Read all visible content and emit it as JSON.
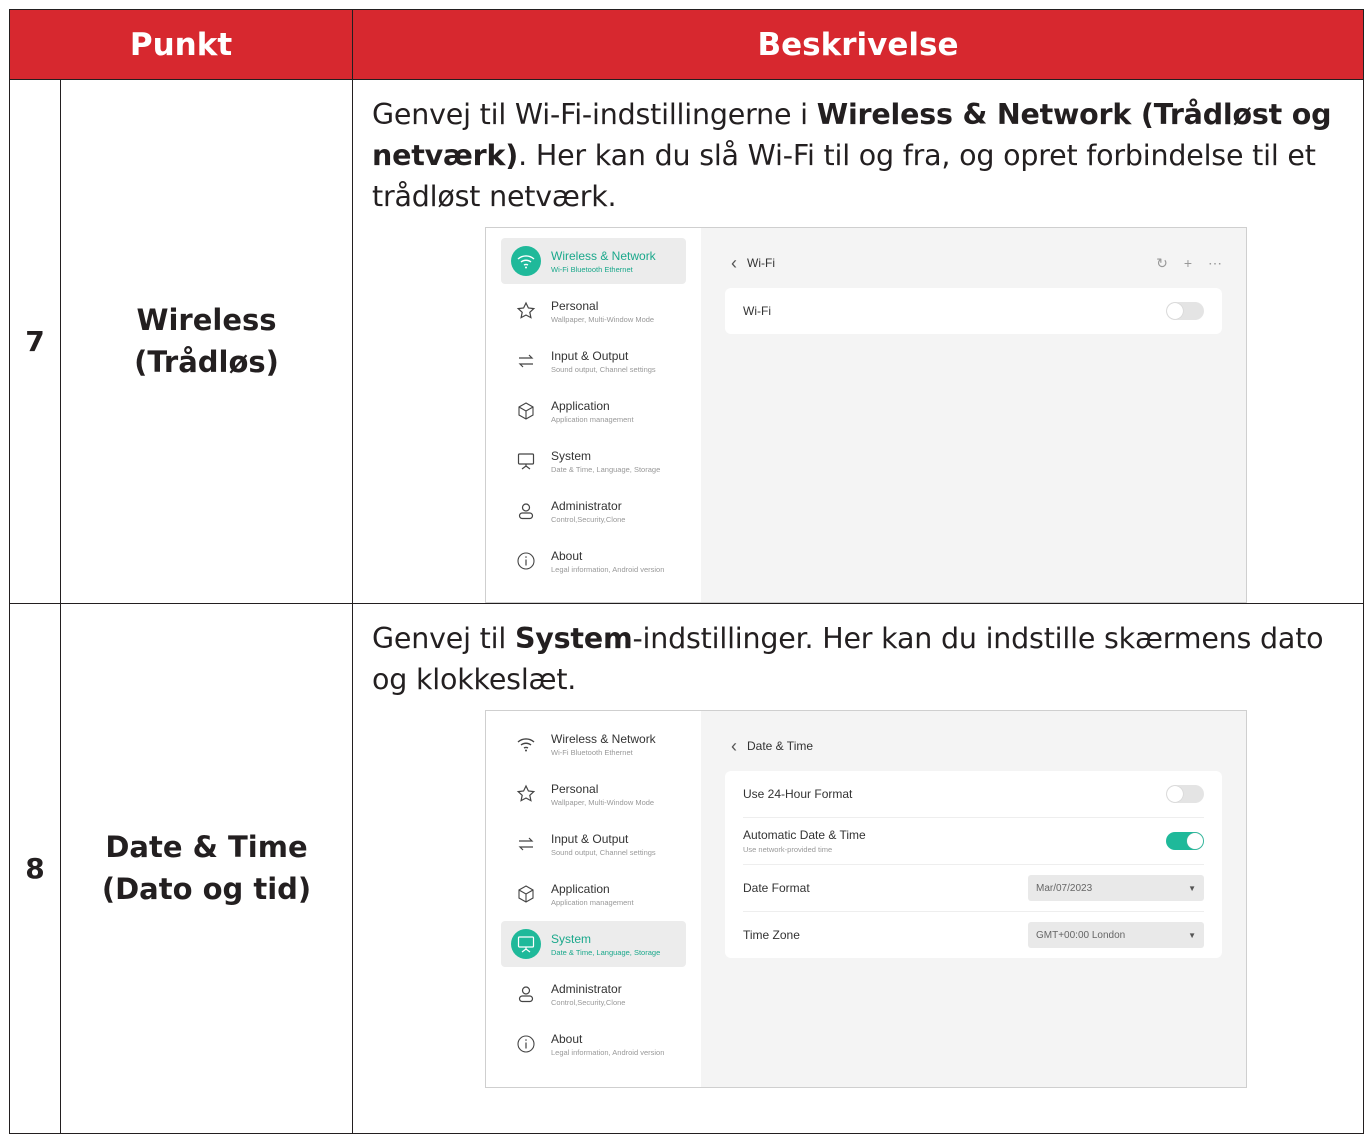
{
  "header": {
    "col1": "Punkt",
    "col2": "Beskrivelse"
  },
  "rows": [
    {
      "num": "7",
      "item_line1": "Wireless",
      "item_line2": "(Trådløs)",
      "desc_pre": "Genvej til Wi-Fi-indstillingerne i ",
      "desc_bold": "Wireless & Network (Trådløst og netværk)",
      "desc_post": ". Her kan du slå Wi-Fi til og fra, og opret forbindelse til et trådløst netværk.",
      "screen": {
        "title": "Wi-Fi",
        "rows": [
          {
            "label": "Wi-Fi"
          }
        ]
      }
    },
    {
      "num": "8",
      "item_line1": "Date & Time",
      "item_line2": "(Dato og tid)",
      "desc_pre": "Genvej til ",
      "desc_bold": "System",
      "desc_post": "-indstillinger. Her kan du indstille skærmens dato og klokkeslæt.",
      "screen": {
        "title": "Date & Time",
        "rows": [
          {
            "label": "Use 24-Hour Format"
          },
          {
            "label": "Automatic Date & Time",
            "sub": "Use network-provided time"
          },
          {
            "label": "Date Format",
            "value": "Mar/07/2023"
          },
          {
            "label": "Time Zone",
            "value": "GMT+00:00 London"
          }
        ]
      }
    }
  ],
  "sidebar": {
    "items": [
      {
        "title": "Wireless & Network",
        "sub": "Wi-Fi Bluetooth Ethernet",
        "icon": "wifi-icon"
      },
      {
        "title": "Personal",
        "sub": "Wallpaper, Multi-Window Mode",
        "icon": "star-icon"
      },
      {
        "title": "Input & Output",
        "sub": "Sound output, Channel settings",
        "icon": "arrows-icon"
      },
      {
        "title": "Application",
        "sub": "Application management",
        "icon": "cube-icon"
      },
      {
        "title": "System",
        "sub": "Date & Time, Language, Storage",
        "icon": "monitor-icon"
      },
      {
        "title": "Administrator",
        "sub": "Control,Security,Clone",
        "icon": "person-icon"
      },
      {
        "title": "About",
        "sub": "Legal information, Android version",
        "icon": "info-icon"
      }
    ]
  },
  "colors": {
    "header_red": "#d7282f",
    "accent_teal": "#1fb99a"
  },
  "toggles": {
    "row7_wifi": false,
    "row8_24h": false,
    "row8_auto": true
  }
}
